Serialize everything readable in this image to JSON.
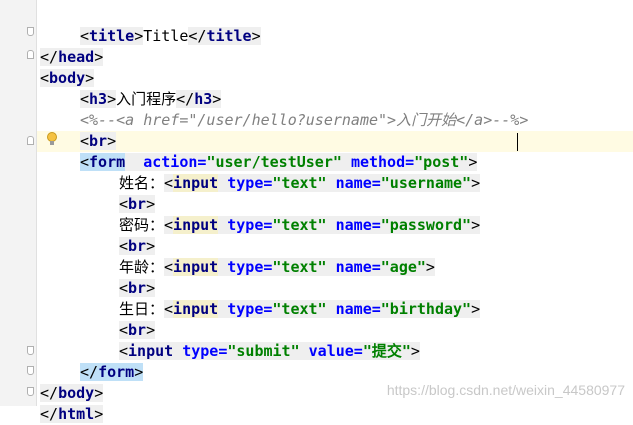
{
  "code": {
    "title_open": "<title>",
    "title_text": "Title",
    "title_close": "</title>",
    "head_close": "</head>",
    "body_open": "<body>",
    "h3_open": "<h3>",
    "h3_text": "入门程序",
    "h3_close": "</h3>",
    "comment_open": "<%--",
    "comment_a_open": "<a href=\"/user/hello?username\">",
    "comment_a_text": "入门开始",
    "comment_a_close": "</a>",
    "comment_close": "--%>",
    "br": "<br>",
    "form_lt": "<",
    "form_name": "form",
    "form_action_attr": "action=",
    "form_action_val": "\"user/testUser\"",
    "form_method_attr": "method=",
    "form_method_val": "\"post\"",
    "gt": ">",
    "lt": "<",
    "lt_slash": "</",
    "br_name": "br",
    "input_name": "input",
    "type_attr": "type=",
    "name_attr": "name=",
    "value_attr": "value=",
    "type_text_val": "\"text\"",
    "type_submit_val": "\"submit\"",
    "fields": [
      {
        "label": "姓名：",
        "name": "\"username\""
      },
      {
        "label": "密码：",
        "name": "\"password\""
      },
      {
        "label": "年龄：",
        "name": "\"age\""
      },
      {
        "label": "生日：",
        "name": "\"birthday\""
      }
    ],
    "submit_value": "\"提交\"",
    "form_close": "</form>",
    "body_close": "</body>",
    "html_close": "</html>"
  },
  "watermark": "https://blog.csdn.net/weixin_44580977",
  "icons": {
    "bulb": "lightbulb-icon",
    "fold": "fold-marker-icon"
  },
  "colors": {
    "tag": "#000080",
    "attr": "#0000ff",
    "value": "#008000",
    "comment": "#808080",
    "caret_row": "#fffbe3"
  }
}
